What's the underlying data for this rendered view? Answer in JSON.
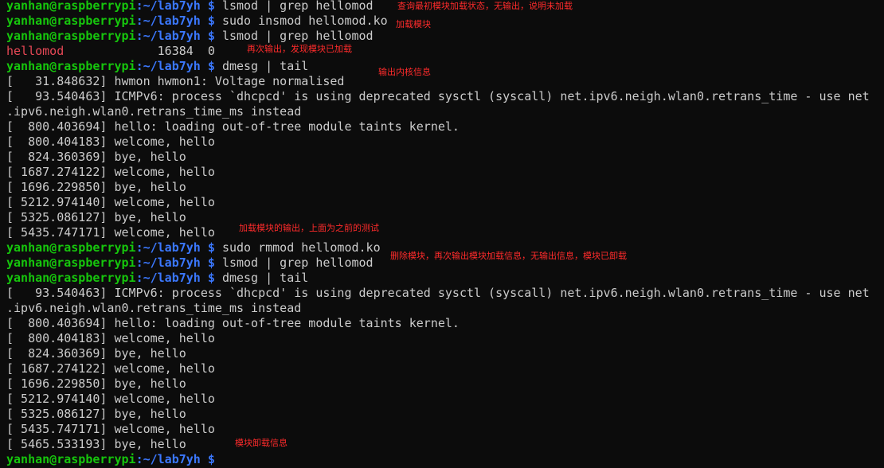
{
  "prompt": {
    "user_host": "yanhan@raspberrypi",
    "path": ":~/lab7yh",
    "symbol": " $ "
  },
  "commands": {
    "c1": "lsmod | grep hellomod",
    "c2": "sudo insmod hellomod.ko",
    "c3": "lsmod | grep hellomod",
    "c4": "dmesg | tail",
    "c5": "sudo rmmod hellomod.ko",
    "c6": "lsmod | grep hellomod",
    "c7": "dmesg | tail"
  },
  "lsmod_result": {
    "name": "hellomod",
    "rest": "             16384  0"
  },
  "dmesg1": [
    "[   31.848632] hwmon hwmon1: Voltage normalised",
    "[   93.540463] ICMPv6: process `dhcpcd' is using deprecated sysctl (syscall) net.ipv6.neigh.wlan0.retrans_time - use net",
    ".ipv6.neigh.wlan0.retrans_time_ms instead",
    "[  800.403694] hello: loading out-of-tree module taints kernel.",
    "[  800.404183] welcome, hello",
    "[  824.360369] bye, hello",
    "[ 1687.274122] welcome, hello",
    "[ 1696.229850] bye, hello",
    "[ 5212.974140] welcome, hello",
    "[ 5325.086127] bye, hello",
    "[ 5435.747171] welcome, hello"
  ],
  "dmesg2": [
    "[   93.540463] ICMPv6: process `dhcpcd' is using deprecated sysctl (syscall) net.ipv6.neigh.wlan0.retrans_time - use net",
    ".ipv6.neigh.wlan0.retrans_time_ms instead",
    "[  800.403694] hello: loading out-of-tree module taints kernel.",
    "[  800.404183] welcome, hello",
    "[  824.360369] bye, hello",
    "[ 1687.274122] welcome, hello",
    "[ 1696.229850] bye, hello",
    "[ 5212.974140] welcome, hello",
    "[ 5325.086127] bye, hello",
    "[ 5435.747171] welcome, hello",
    "[ 5465.533193] bye, hello"
  ],
  "annotations": {
    "a1": "查询最初模块加载状态，无输出，说明未加载",
    "a2": "加载模块",
    "a3": "再次输出，发现模块已加载",
    "a4": "输出内核信息",
    "a5": "加载模块的输出，上面为之前的测试",
    "a6": "删除模块，再次输出模块加载信息，无输出信息，模块已卸载",
    "a7": "模块卸载信息"
  },
  "colors": {
    "background": "#0c0c0c",
    "text": "#cccccc",
    "user_host": "#16c60c",
    "path": "#3b78ff",
    "module_name": "#e74856",
    "annotation": "#ff2b2b"
  }
}
